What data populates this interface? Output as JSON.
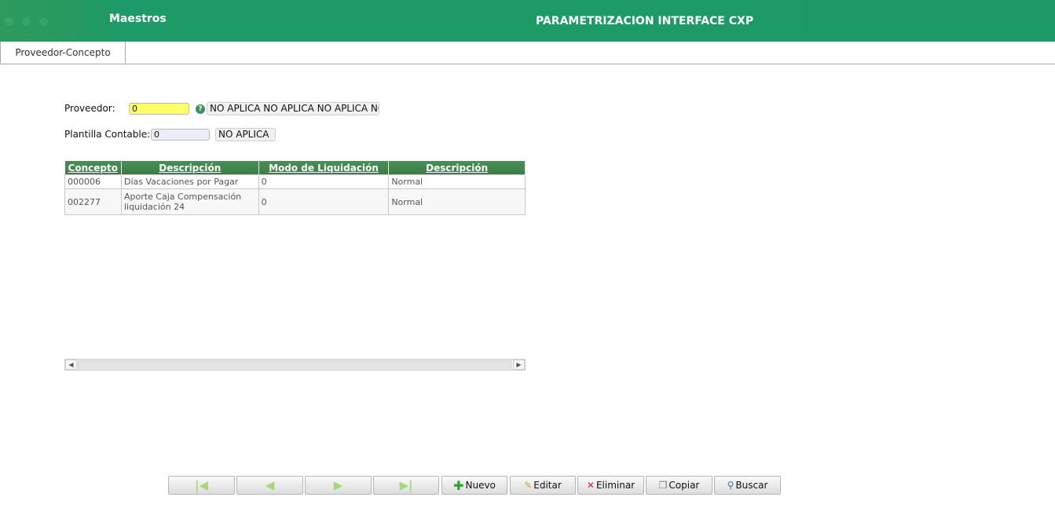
{
  "header": {
    "app_title": "Maestros",
    "page_title": "PARAMETRIZACION INTERFACE CXP"
  },
  "tabs": [
    {
      "label": "Proveedor-Concepto"
    }
  ],
  "form": {
    "proveedor_label": "Proveedor:",
    "proveedor_value": "0",
    "proveedor_desc": "NO APLICA NO APLICA NO APLICA NO",
    "plantilla_label": "Plantilla Contable:",
    "plantilla_value": "0",
    "plantilla_desc": "NO APLICA"
  },
  "grid": {
    "columns": [
      "Concepto",
      "Descripción",
      "Modo de Liquidación",
      "Descripción"
    ],
    "rows": [
      [
        "000006",
        "Días Vacaciones por Pagar",
        "0",
        "Normal"
      ],
      [
        "002277",
        "Aporte Caja Compensación liquidación 24",
        "0",
        "Normal"
      ]
    ]
  },
  "toolbar": {
    "nuevo": "Nuevo",
    "editar": "Editar",
    "eliminar": "Eliminar",
    "copiar": "Copiar",
    "buscar": "Buscar"
  },
  "colors": {
    "header": "#1d9966",
    "grid_header": "#3f8450",
    "proveedor_input": "#ffff66"
  }
}
